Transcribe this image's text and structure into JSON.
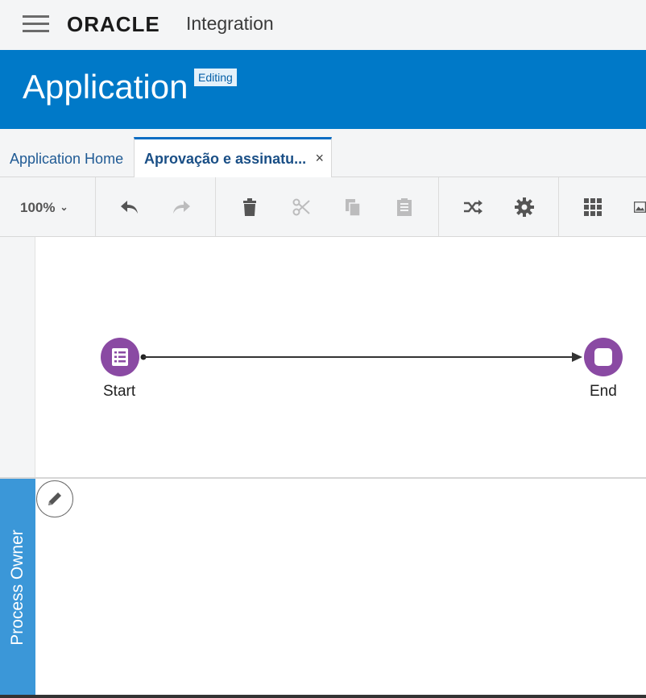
{
  "header": {
    "brand": "ORACLE",
    "brand_suffix": "Integration"
  },
  "banner": {
    "title": "Application",
    "badge": "Editing"
  },
  "tabs": {
    "home": "Application Home",
    "active": "Aprovação e assinatu...",
    "close": "×"
  },
  "toolbar": {
    "zoom": "100%",
    "icons": [
      "undo-icon",
      "redo-icon",
      "delete-icon",
      "cut-icon",
      "copy-icon",
      "paste-icon",
      "shuffle-icon",
      "gear-icon",
      "grid-icon",
      "image-icon"
    ]
  },
  "canvas": {
    "start_label": "Start",
    "end_label": "End"
  },
  "lane": {
    "label": "Process Owner"
  },
  "colors": {
    "banner": "#0079c8",
    "node": "#8a4aa3",
    "lane_tab": "#3b97d8"
  }
}
